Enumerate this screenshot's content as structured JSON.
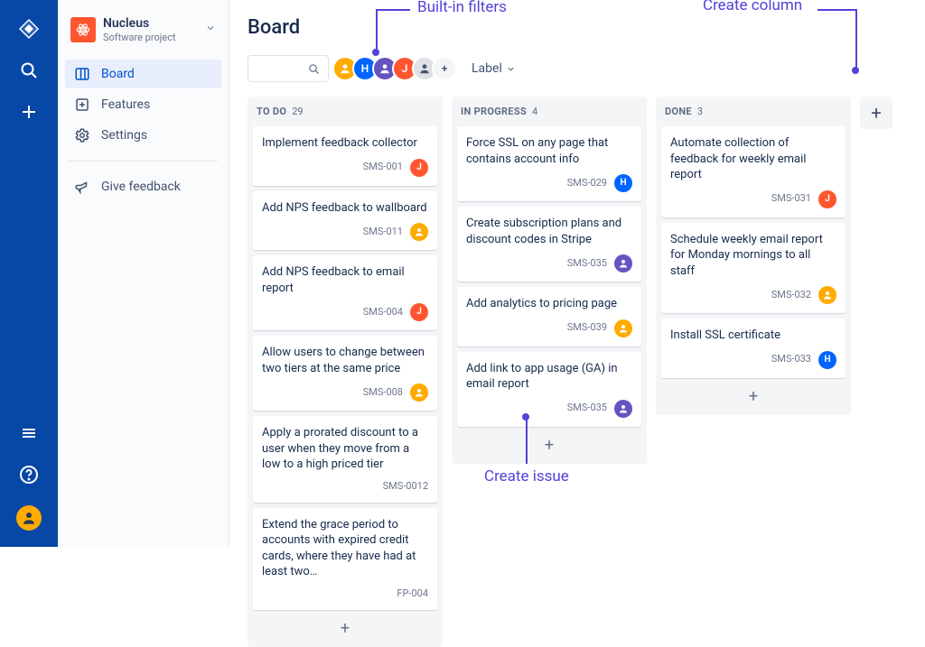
{
  "project": {
    "name": "Nucleus",
    "type": "Software project"
  },
  "nav": {
    "board": "Board",
    "features": "Features",
    "settings": "Settings",
    "feedback": "Give feedback"
  },
  "page_title": "Board",
  "toolbar": {
    "label_filter": "Label"
  },
  "avatars": [
    {
      "letter": "",
      "color": "orange"
    },
    {
      "letter": "H",
      "color": "blue"
    },
    {
      "letter": "",
      "color": "purple"
    },
    {
      "letter": "J",
      "color": "red"
    },
    {
      "letter": "",
      "color": "grey"
    }
  ],
  "columns": [
    {
      "name": "TO DO",
      "count": 29,
      "cards": [
        {
          "title": "Implement feedback collector",
          "key": "SMS-001",
          "assignee": "J",
          "color": "red"
        },
        {
          "title": "Add NPS feedback to wallboard",
          "key": "SMS-011",
          "assignee": "",
          "color": "orange"
        },
        {
          "title": "Add NPS feedback to email report",
          "key": "SMS-004",
          "assignee": "J",
          "color": "red"
        },
        {
          "title": "Allow users to change between two tiers at the same price",
          "key": "SMS-008",
          "assignee": "",
          "color": "orange"
        },
        {
          "title": "Apply a prorated discount to a user when they move from a low to a high priced tier",
          "key": "SMS-0012",
          "assignee": null,
          "color": null
        },
        {
          "title": "Extend the grace period to accounts with expired credit cards, where they have had at least two…",
          "key": "FP-004",
          "assignee": null,
          "color": null
        }
      ]
    },
    {
      "name": "IN PROGRESS",
      "count": 4,
      "cards": [
        {
          "title": "Force SSL on any page that contains account info",
          "key": "SMS-029",
          "assignee": "H",
          "color": "blue"
        },
        {
          "title": "Create subscription plans and discount codes in Stripe",
          "key": "SMS-035",
          "assignee": "",
          "color": "purple"
        },
        {
          "title": "Add analytics to pricing page",
          "key": "SMS-039",
          "assignee": "",
          "color": "orange"
        },
        {
          "title": "Add link to app usage (GA) in email report",
          "key": "SMS-035",
          "assignee": "",
          "color": "purple"
        }
      ]
    },
    {
      "name": "DONE",
      "count": 3,
      "cards": [
        {
          "title": "Automate collection of feedback for weekly email report",
          "key": "SMS-031",
          "assignee": "J",
          "color": "red"
        },
        {
          "title": "Schedule weekly email report for Monday mornings to all staff",
          "key": "SMS-032",
          "assignee": "",
          "color": "orange"
        },
        {
          "title": "Install SSL certificate",
          "key": "SMS-033",
          "assignee": "H",
          "color": "blue"
        }
      ]
    }
  ],
  "annotations": {
    "filters": "Built-in filters",
    "create_issue": "Create issue",
    "create_column": "Create column"
  }
}
